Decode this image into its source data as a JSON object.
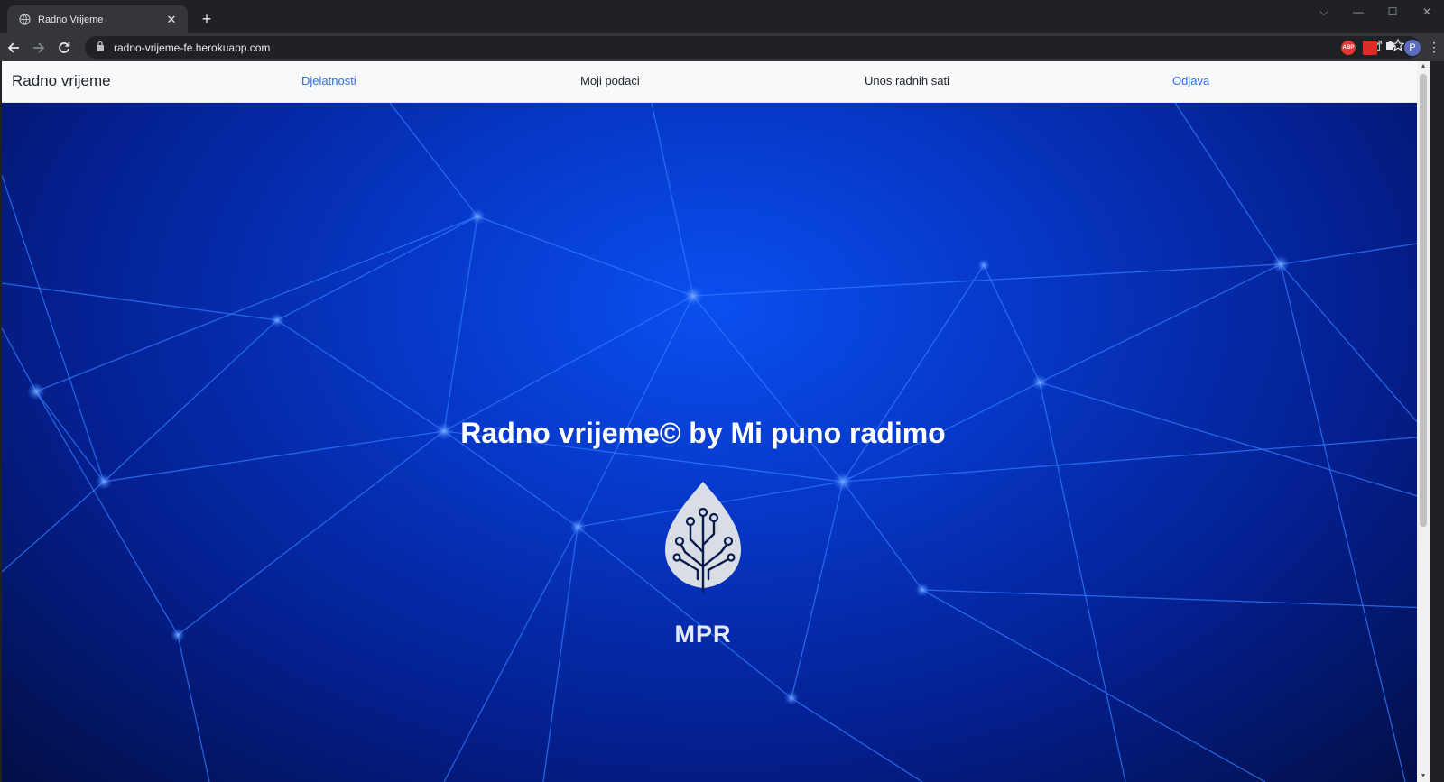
{
  "browser": {
    "tab_title": "Radno Vrijeme",
    "tab_close": "✕",
    "new_tab": "+",
    "url": "radno-vrijeme-fe.herokuapp.com",
    "avatar_letter": "P",
    "abp_label": "ABP",
    "win_controls": {
      "dropdown": "⌵",
      "minimize": "—",
      "maximize": "☐",
      "close": "✕"
    }
  },
  "navbar": {
    "brand": "Radno vrijeme",
    "links": [
      {
        "label": "Djelatnosti",
        "color": "#2f6fdd"
      },
      {
        "label": "Moji podaci",
        "color": "#212529"
      },
      {
        "label": "Unos radnih sati",
        "color": "#212529"
      },
      {
        "label": "Odjava",
        "color": "#2f6fdd"
      }
    ]
  },
  "hero": {
    "title": "Radno vrijeme© by Mi puno radimo",
    "logo_text": "MPR",
    "logo_icon": "leaf-circuit-icon"
  },
  "colors": {
    "accent_link": "#2f6fdd",
    "hero_bg": "#0638c8",
    "chrome_bg": "#202124"
  }
}
